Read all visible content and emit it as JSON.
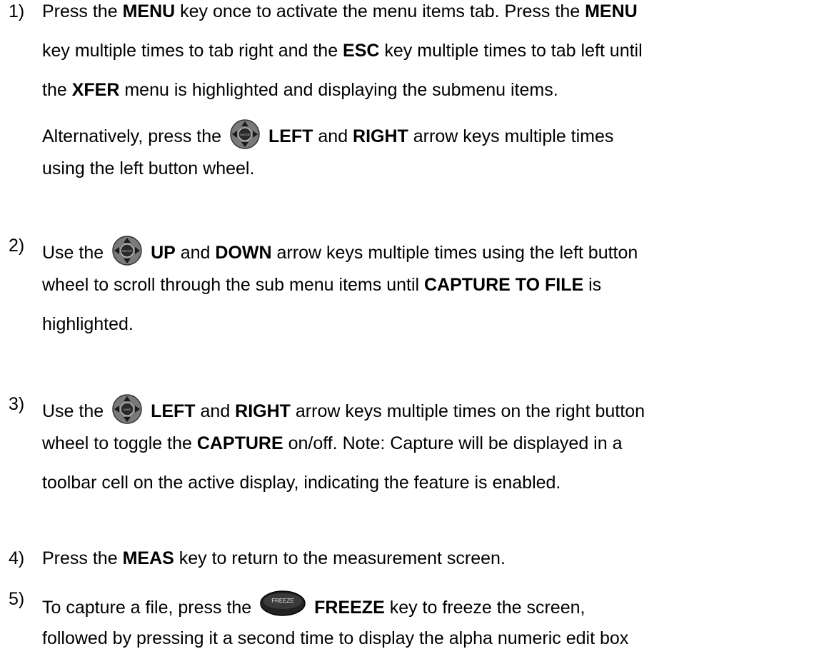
{
  "steps": [
    {
      "number": "1)",
      "lines": [
        [
          "Press the ",
          {
            "b": "MENU"
          },
          " key once to activate the menu items tab.  Press the ",
          {
            "b": "MENU"
          }
        ],
        [
          "key multiple times to tab right and the ",
          {
            "b": "ESC"
          },
          " key multiple times to tab left until"
        ],
        [
          "the ",
          {
            "b": "XFER"
          },
          " menu is highlighted and displaying the submenu items."
        ],
        [
          "Alternatively, press the ",
          {
            "icon": "wheel-left"
          },
          " ",
          {
            "b": "LEFT"
          },
          " and ",
          {
            "b": "RIGHT"
          },
          " arrow keys multiple times"
        ],
        [
          "using the left button wheel."
        ]
      ]
    },
    {
      "number": "2)",
      "lines": [
        [
          "Use the ",
          {
            "icon": "wheel-left"
          },
          " ",
          {
            "b": "UP"
          },
          " and ",
          {
            "b": "DOWN"
          },
          " arrow keys multiple times using the left button"
        ],
        [
          "wheel to scroll through the sub menu items until ",
          {
            "b": "CAPTURE TO FILE"
          },
          " is"
        ],
        [
          "highlighted."
        ]
      ]
    },
    {
      "number": "3)",
      "lines": [
        [
          "Use the ",
          {
            "icon": "wheel-right"
          },
          " ",
          {
            "b": "LEFT"
          },
          " and ",
          {
            "b": "RIGHT"
          },
          " arrow keys multiple times on the right button"
        ],
        [
          "wheel to toggle the ",
          {
            "b": "CAPTURE"
          },
          " on/off.  Note:  Capture will be displayed in a"
        ],
        [
          "toolbar cell on the active display, indicating the feature is enabled."
        ]
      ]
    },
    {
      "number": "4)",
      "lines": [
        [
          "Press the ",
          {
            "b": "MEAS"
          },
          " key to return to the measurement screen."
        ]
      ]
    },
    {
      "number": "5)",
      "lines": [
        [
          "To capture a file, press the ",
          {
            "icon": "freeze-key"
          },
          " ",
          {
            "b": "FREEZE"
          },
          " key to freeze the screen,"
        ],
        [
          "followed by pressing it a second time to display the alpha numeric edit box"
        ]
      ]
    }
  ],
  "icons": {
    "wheel-left": {
      "center_label": "ENTER"
    },
    "wheel-right": {
      "center_label": "SAVE"
    },
    "freeze-key": {
      "label": "FREEZE"
    }
  }
}
